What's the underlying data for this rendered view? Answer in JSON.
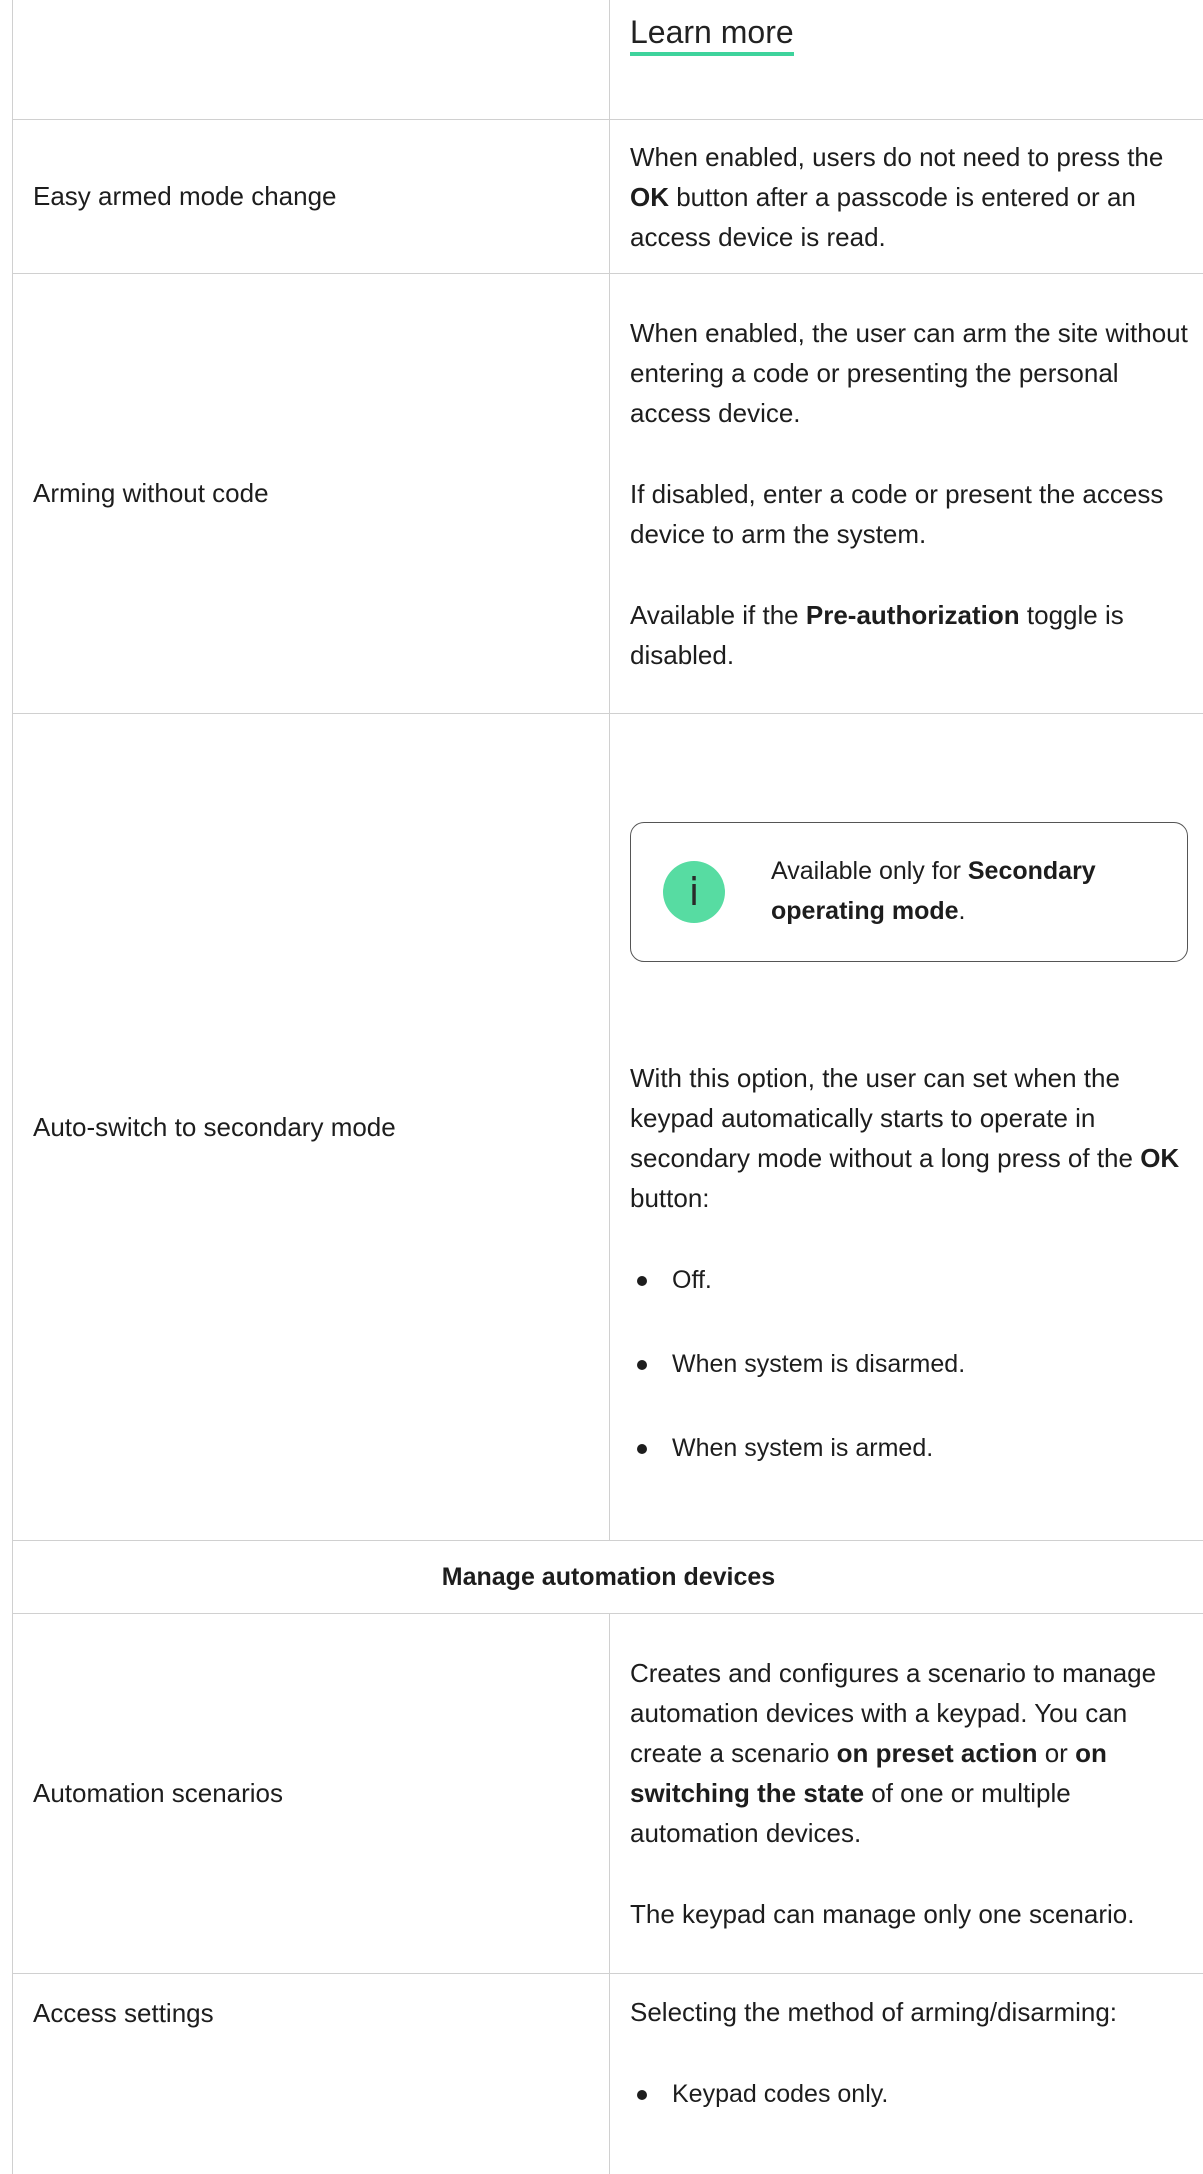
{
  "learn_more": "Learn more",
  "rows": {
    "easy_armed": {
      "label": "Easy armed mode change",
      "text_pre": "When enabled, users do not need to press the ",
      "text_bold": "OK",
      "text_post": " button after a passcode is entered or an access device is read."
    },
    "arming_without_code": {
      "label": "Arming without code",
      "p1": "When enabled, the user can arm the site without entering a code or presenting the personal access device.",
      "p2": "If disabled, enter a code or present the access device to arm the system.",
      "p3_pre": "Available if the ",
      "p3_bold": "Pre-authorization",
      "p3_post": " toggle is disabled."
    },
    "auto_switch": {
      "label": "Auto-switch to secondary mode",
      "note_pre": "Available only for ",
      "note_bold": "Secondary operating mode",
      "note_post": ".",
      "text_pre": "With this option, the user can set when the keypad automatically starts to operate in secondary mode without a long press of the ",
      "text_bold": "OK",
      "text_post": " button:",
      "options": [
        "Off.",
        "When system is disarmed.",
        "When system is armed."
      ]
    },
    "section_title": "Manage automation devices",
    "automation_scenarios": {
      "label": "Automation scenarios",
      "t1": "Creates and configures a scenario to manage automation devices with a keypad. You can create a scenario ",
      "b1": "on preset action",
      "t2": " or ",
      "b2": "on switching the state",
      "t3": " of one or multiple automation devices.",
      "p2": "The keypad can manage only one scenario."
    },
    "access_settings": {
      "label": "Access settings",
      "text": "Selecting the method of arming/disarming:",
      "options": [
        "Keypad codes only."
      ]
    }
  },
  "icons": {
    "note_icon": "info-icon"
  },
  "colors": {
    "accent": "#3ed39c",
    "info_circle": "#57dca2",
    "border": "#d0d0d0"
  }
}
